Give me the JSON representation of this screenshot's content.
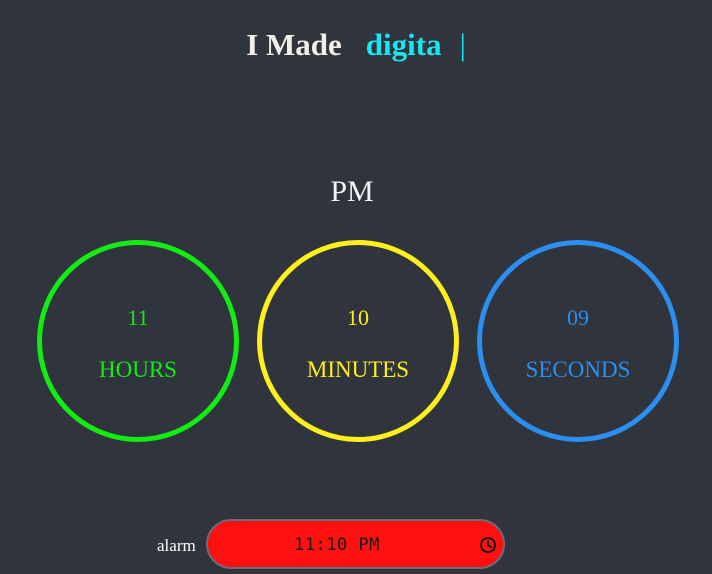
{
  "header": {
    "prefix": "I Made",
    "typed": "digita",
    "cursor": "|"
  },
  "clock": {
    "period": "PM",
    "hours": {
      "value": "11",
      "label": "HOURS"
    },
    "minutes": {
      "value": "10",
      "label": "MINUTES"
    },
    "seconds": {
      "value": "09",
      "label": "SECONDS"
    }
  },
  "alarm": {
    "label": "alarm",
    "value": "11:10 PM",
    "icon": "clock-icon"
  },
  "colors": {
    "background": "#2f343d",
    "hours": "#13ec13",
    "minutes": "#ffef1c",
    "seconds": "#2c8ef0",
    "typed": "#18e7f2",
    "alarm_field": "#ff1010"
  }
}
